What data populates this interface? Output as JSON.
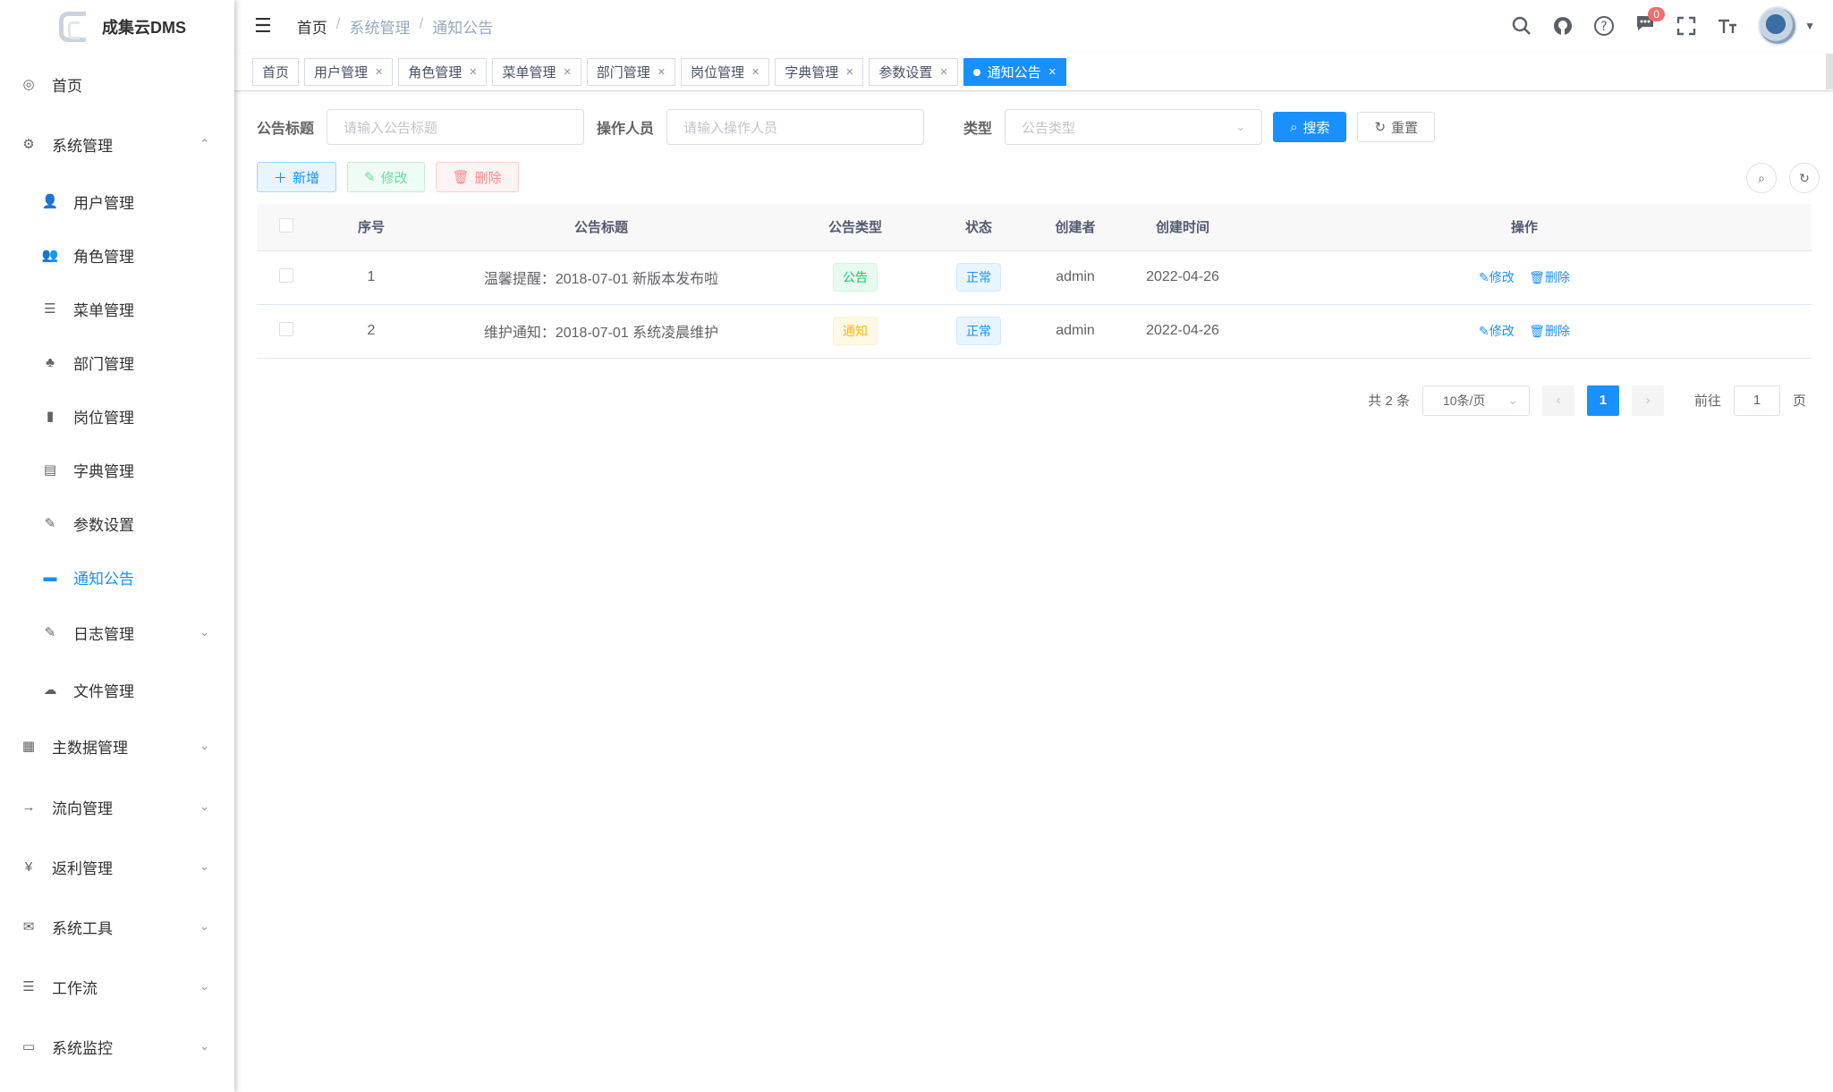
{
  "app": {
    "title": "成集云DMS"
  },
  "sidebar": {
    "items": [
      {
        "label": "首页",
        "icon": "dashboard-icon",
        "glyph": "◎"
      },
      {
        "label": "系统管理",
        "icon": "system-icon",
        "glyph": "⚙",
        "arrow": "⌃"
      },
      {
        "label": "用户管理",
        "icon": "user-icon",
        "glyph": "👤"
      },
      {
        "label": "角色管理",
        "icon": "peoples-icon",
        "glyph": "👥"
      },
      {
        "label": "菜单管理",
        "icon": "tree-table-icon",
        "glyph": "☰"
      },
      {
        "label": "部门管理",
        "icon": "tree-icon",
        "glyph": "♣"
      },
      {
        "label": "岗位管理",
        "icon": "post-icon",
        "glyph": "▮"
      },
      {
        "label": "字典管理",
        "icon": "dict-icon",
        "glyph": "▤"
      },
      {
        "label": "参数设置",
        "icon": "edit-icon",
        "glyph": "✎"
      },
      {
        "label": "通知公告",
        "icon": "message-icon",
        "glyph": "▬"
      },
      {
        "label": "日志管理",
        "icon": "log-icon",
        "glyph": "✎",
        "arrow": "⌄"
      },
      {
        "label": "文件管理",
        "icon": "cloud-icon",
        "glyph": "☁"
      },
      {
        "label": "主数据管理",
        "icon": "data-icon",
        "glyph": "▦",
        "arrow": "⌄"
      },
      {
        "label": "流向管理",
        "icon": "flow-icon",
        "glyph": "→",
        "arrow": "⌄"
      },
      {
        "label": "返利管理",
        "icon": "yen-icon",
        "glyph": "¥",
        "arrow": "⌄"
      },
      {
        "label": "系统工具",
        "icon": "tool-icon",
        "glyph": "✉",
        "arrow": "⌄"
      },
      {
        "label": "工作流",
        "icon": "workflow-icon",
        "glyph": "☰",
        "arrow": "⌄"
      },
      {
        "label": "系统监控",
        "icon": "monitor-icon",
        "glyph": "▭",
        "arrow": "⌄"
      }
    ]
  },
  "header": {
    "breadcrumb": [
      "首页",
      "系统管理",
      "通知公告"
    ],
    "badge": "0"
  },
  "tags": [
    {
      "label": "首页"
    },
    {
      "label": "用户管理"
    },
    {
      "label": "角色管理"
    },
    {
      "label": "菜单管理"
    },
    {
      "label": "部门管理"
    },
    {
      "label": "岗位管理"
    },
    {
      "label": "字典管理"
    },
    {
      "label": "参数设置"
    },
    {
      "label": "通知公告"
    }
  ],
  "filters": {
    "title_label": "公告标题",
    "title_placeholder": "请输入公告标题",
    "operator_label": "操作人员",
    "operator_placeholder": "请输入操作人员",
    "type_label": "类型",
    "type_placeholder": "公告类型",
    "search_btn": "搜索",
    "reset_btn": "重置"
  },
  "toolbar": {
    "add": "新增",
    "edit": "修改",
    "delete": "删除"
  },
  "table": {
    "headers": [
      "序号",
      "公告标题",
      "公告类型",
      "状态",
      "创建者",
      "创建时间",
      "操作"
    ],
    "rows": [
      {
        "id": "1",
        "title": "温馨提醒：2018-07-01 新版本发布啦",
        "type": "公告",
        "status": "正常",
        "creator": "admin",
        "time": "2022-04-26",
        "edit": "修改",
        "delete": "删除"
      },
      {
        "id": "2",
        "title": "维护通知：2018-07-01 系统凌晨维护",
        "type": "通知",
        "status": "正常",
        "creator": "admin",
        "time": "2022-04-26",
        "edit": "修改",
        "delete": "删除"
      }
    ]
  },
  "pagination": {
    "total": "共 2 条",
    "page_size": "10条/页",
    "current": "1",
    "goto_label": "前往",
    "goto_value": "1",
    "page_suffix": "页"
  },
  "colors": {
    "primary": "#1890ff",
    "success": "#13ce66",
    "warning": "#ffba00",
    "danger": "#ff4949"
  }
}
